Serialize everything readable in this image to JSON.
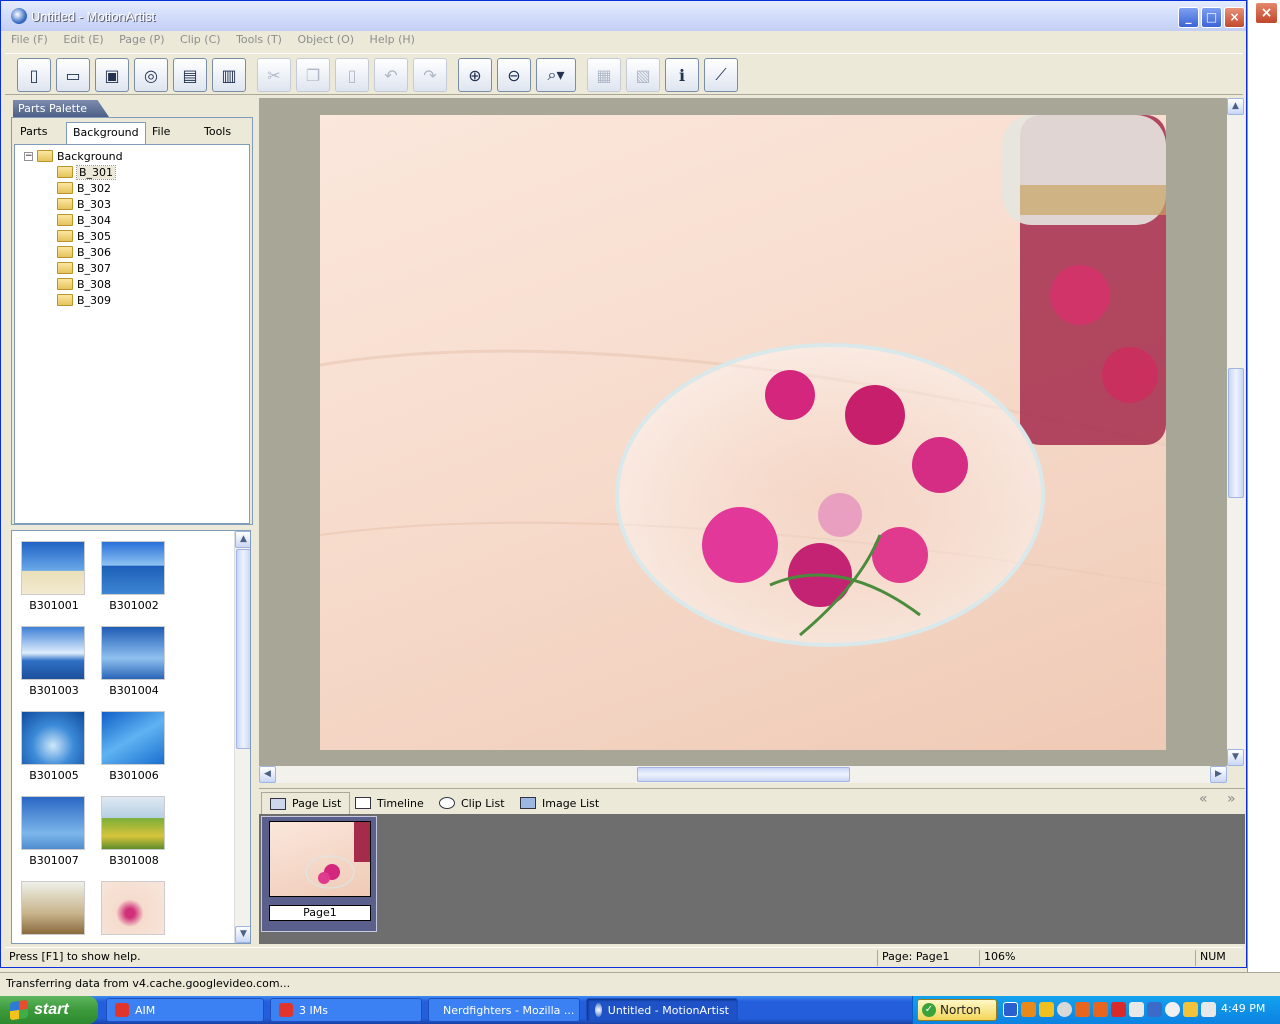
{
  "window": {
    "title": "Untitled - MotionArtist"
  },
  "menu": [
    "File (F)",
    "Edit (E)",
    "Page (P)",
    "Clip (C)",
    "Tools (T)",
    "Object (O)",
    "Help (H)"
  ],
  "palette": {
    "title": "Parts Palette",
    "tabs": [
      "Parts",
      "Background",
      "File",
      "Tools"
    ],
    "active_tab": "Background",
    "tree_root": "Background",
    "folders": [
      "B_301",
      "B_302",
      "B_303",
      "B_304",
      "B_305",
      "B_306",
      "B_307",
      "B_308",
      "B_309"
    ],
    "selected_folder": "B_301"
  },
  "thumbnails": [
    "B301001",
    "B301002",
    "B301003",
    "B301004",
    "B301005",
    "B301006",
    "B301007",
    "B301008"
  ],
  "bottom_tabs": [
    "Page List",
    "Timeline",
    "Clip List",
    "Image List"
  ],
  "pages": [
    "Page1"
  ],
  "statusbar": {
    "help": "Press [F1] to show help.",
    "page": "Page: Page1",
    "zoom": "106%",
    "num": "NUM"
  },
  "browser_status": "Transferring data from v4.cache.googlevideo.com...",
  "taskbar": {
    "start": "start",
    "tasks": [
      "AIM",
      "3 IMs",
      "Nerdfighters - Mozilla ...",
      "Untitled - MotionArtist"
    ],
    "norton": "Norton",
    "clock": "4:49 PM"
  },
  "colors": {
    "title_blue": "#0a246a",
    "canvas_gray": "#a7a697",
    "taskbar_blue": "#245edb"
  }
}
